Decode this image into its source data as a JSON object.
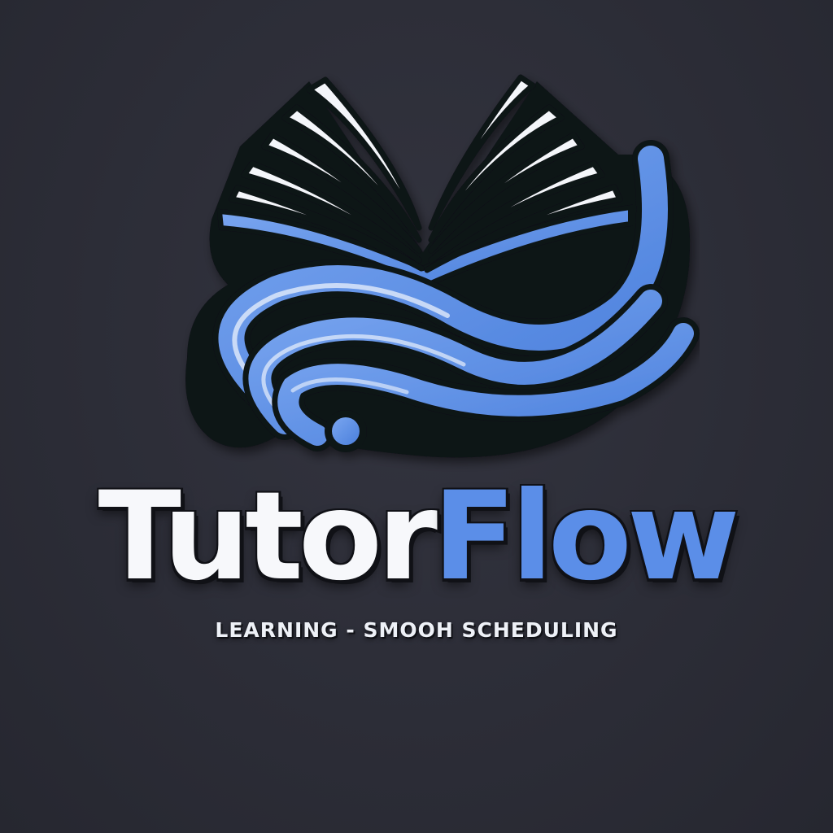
{
  "brand": {
    "name_part1": "Tutor",
    "name_part2": "Flow",
    "tagline": "LEARNING - SMOOH SCHEDULING"
  },
  "colors": {
    "background": "#2c2d37",
    "primary_white": "#f7f8fb",
    "accent_blue": "#5b8ee8",
    "outline": "#101116"
  },
  "icons": {
    "emblem": "open-book-wave-icon"
  }
}
